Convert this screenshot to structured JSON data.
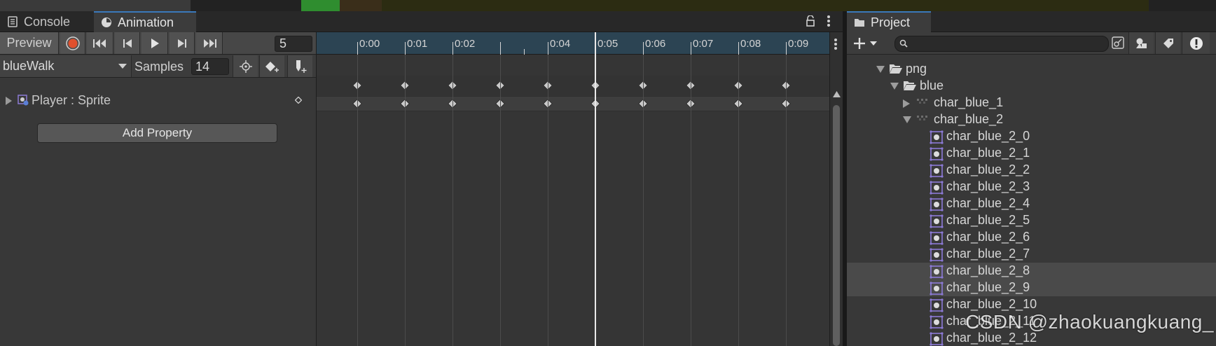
{
  "animation_window": {
    "tabs": [
      {
        "label": "Console",
        "icon": "console-icon",
        "active": false
      },
      {
        "label": "Animation",
        "icon": "clock-icon",
        "active": true
      }
    ],
    "toolbar": {
      "preview_label": "Preview",
      "current_frame": "5",
      "clip_name": "blueWalk",
      "samples_label": "Samples",
      "samples_value": "14"
    },
    "property": {
      "label": "Player : Sprite",
      "icon": "sprite-renderer-icon"
    },
    "add_property_label": "Add Property",
    "timeline": {
      "ticks": [
        "0:00",
        "0:01",
        "0:02",
        "",
        "0:04",
        "0:05",
        "0:06",
        "0:07",
        "0:08",
        "0:09"
      ],
      "current_time_index": 5,
      "keyframes_summary": [
        0,
        1,
        2,
        3,
        4,
        5,
        6,
        7,
        8,
        9
      ],
      "keyframes_sprite": [
        0,
        1,
        2,
        3,
        4,
        5,
        6,
        7,
        8,
        9
      ]
    }
  },
  "project_window": {
    "tab_label": "Project",
    "search": {
      "value": "",
      "placeholder": ""
    },
    "tree": [
      {
        "label": "png",
        "depth": 0,
        "type": "folder-open",
        "expanded": true
      },
      {
        "label": "blue",
        "depth": 1,
        "type": "folder-open",
        "expanded": true
      },
      {
        "label": "char_blue_1",
        "depth": 2,
        "type": "texture",
        "expanded": false
      },
      {
        "label": "char_blue_2",
        "depth": 2,
        "type": "texture",
        "expanded": true
      },
      {
        "label": "char_blue_2_0",
        "depth": 3,
        "type": "sprite"
      },
      {
        "label": "char_blue_2_1",
        "depth": 3,
        "type": "sprite"
      },
      {
        "label": "char_blue_2_2",
        "depth": 3,
        "type": "sprite"
      },
      {
        "label": "char_blue_2_3",
        "depth": 3,
        "type": "sprite"
      },
      {
        "label": "char_blue_2_4",
        "depth": 3,
        "type": "sprite"
      },
      {
        "label": "char_blue_2_5",
        "depth": 3,
        "type": "sprite"
      },
      {
        "label": "char_blue_2_6",
        "depth": 3,
        "type": "sprite"
      },
      {
        "label": "char_blue_2_7",
        "depth": 3,
        "type": "sprite"
      },
      {
        "label": "char_blue_2_8",
        "depth": 3,
        "type": "sprite",
        "selected": true
      },
      {
        "label": "char_blue_2_9",
        "depth": 3,
        "type": "sprite",
        "selected": true
      },
      {
        "label": "char_blue_2_10",
        "depth": 3,
        "type": "sprite"
      },
      {
        "label": "char_blue_2_11",
        "depth": 3,
        "type": "sprite"
      },
      {
        "label": "char_blue_2_12",
        "depth": 3,
        "type": "sprite"
      }
    ]
  },
  "watermark": "CSDN @zhaokuangkuang_",
  "colors": {
    "record_red": "#e0502e",
    "ruler_blue": "#2c4453",
    "tab_accent": "#3a79bb",
    "sprite_icon": "#8c7ad6"
  }
}
